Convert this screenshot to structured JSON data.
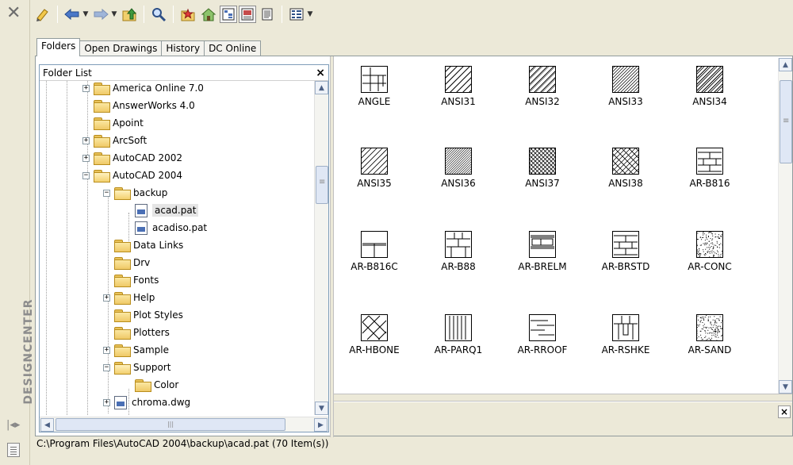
{
  "window": {
    "vertical_title": "DESIGNCENTER",
    "close_glyph": "✕"
  },
  "tabs": [
    {
      "label": "Folders",
      "active": true
    },
    {
      "label": "Open Drawings",
      "active": false
    },
    {
      "label": "History",
      "active": false
    },
    {
      "label": "DC Online",
      "active": false
    }
  ],
  "folder_list": {
    "title": "Folder List",
    "close_glyph": "×",
    "items": [
      {
        "label": "America Online 7.0",
        "expander": "+",
        "type": "folder"
      },
      {
        "label": "AnswerWorks 4.0",
        "expander": "",
        "type": "folder"
      },
      {
        "label": "Apoint",
        "expander": "",
        "type": "folder"
      },
      {
        "label": "ArcSoft",
        "expander": "+",
        "type": "folder"
      },
      {
        "label": "AutoCAD 2002",
        "expander": "+",
        "type": "folder"
      },
      {
        "label": "AutoCAD 2004",
        "expander": "−",
        "type": "folder-open"
      },
      {
        "label": "backup",
        "expander": "−",
        "type": "folder-open"
      },
      {
        "label": "acad.pat",
        "expander": "",
        "type": "file",
        "selected": true
      },
      {
        "label": "acadiso.pat",
        "expander": "",
        "type": "file"
      },
      {
        "label": "Data Links",
        "expander": "",
        "type": "folder"
      },
      {
        "label": "Drv",
        "expander": "",
        "type": "folder"
      },
      {
        "label": "Fonts",
        "expander": "",
        "type": "folder"
      },
      {
        "label": "Help",
        "expander": "+",
        "type": "folder"
      },
      {
        "label": "Plot Styles",
        "expander": "",
        "type": "folder"
      },
      {
        "label": "Plotters",
        "expander": "",
        "type": "folder"
      },
      {
        "label": "Sample",
        "expander": "+",
        "type": "folder"
      },
      {
        "label": "Support",
        "expander": "−",
        "type": "folder-open"
      },
      {
        "label": "Color",
        "expander": "",
        "type": "folder"
      },
      {
        "label": "chroma.dwg",
        "expander": "+",
        "type": "file"
      }
    ]
  },
  "patterns": [
    {
      "label": "ANGLE",
      "pattern": "angle"
    },
    {
      "label": "ANSI31",
      "pattern": "ansi31"
    },
    {
      "label": "ANSI32",
      "pattern": "ansi32"
    },
    {
      "label": "ANSI33",
      "pattern": "ansi33"
    },
    {
      "label": "ANSI34",
      "pattern": "ansi34"
    },
    {
      "label": "ANSI35",
      "pattern": "ansi35"
    },
    {
      "label": "ANSI36",
      "pattern": "ansi36"
    },
    {
      "label": "ANSI37",
      "pattern": "ansi37"
    },
    {
      "label": "ANSI38",
      "pattern": "ansi38"
    },
    {
      "label": "AR-B816",
      "pattern": "brick"
    },
    {
      "label": "AR-B816C",
      "pattern": "b816c"
    },
    {
      "label": "AR-B88",
      "pattern": "b88"
    },
    {
      "label": "AR-BRELM",
      "pattern": "brelm"
    },
    {
      "label": "AR-BRSTD",
      "pattern": "brick"
    },
    {
      "label": "AR-CONC",
      "pattern": "dots"
    },
    {
      "label": "AR-HBONE",
      "pattern": "hbone"
    },
    {
      "label": "AR-PARQ1",
      "pattern": "parq"
    },
    {
      "label": "AR-RROOF",
      "pattern": "rroof"
    },
    {
      "label": "AR-RSHKE",
      "pattern": "rshke"
    },
    {
      "label": "AR-SAND",
      "pattern": "dots"
    }
  ],
  "status": "C:\\Program Files\\AutoCAD 2004\\backup\\acad.pat (70 Item(s))"
}
